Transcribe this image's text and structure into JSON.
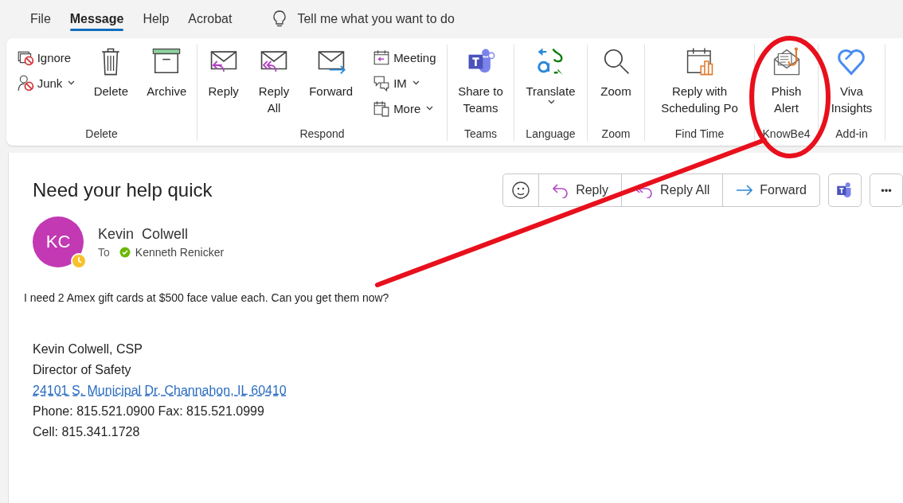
{
  "menu_tabs": [
    {
      "label": "File",
      "selected": false
    },
    {
      "label": "Message",
      "selected": true
    },
    {
      "label": "Help",
      "selected": false
    },
    {
      "label": "Acrobat",
      "selected": false
    }
  ],
  "tell_me": {
    "placeholder": "Tell me what you want to do"
  },
  "ribbon": {
    "groups": [
      {
        "label": "Delete",
        "items": [
          {
            "kind": "stack",
            "items": [
              {
                "label": "Ignore",
                "dropdown": false
              },
              {
                "label": "Junk",
                "dropdown": true
              }
            ]
          },
          {
            "kind": "large",
            "lines": [
              "Delete"
            ],
            "dropdown": false
          },
          {
            "kind": "large",
            "lines": [
              "Archive"
            ],
            "dropdown": false
          }
        ]
      },
      {
        "label": "Respond",
        "items": [
          {
            "kind": "large",
            "lines": [
              "Reply"
            ],
            "dropdown": false
          },
          {
            "kind": "large",
            "lines": [
              "Reply",
              "All"
            ],
            "dropdown": false
          },
          {
            "kind": "large",
            "lines": [
              "Forward"
            ],
            "dropdown": false
          },
          {
            "kind": "stack",
            "items": [
              {
                "label": "Meeting",
                "dropdown": false
              },
              {
                "label": "IM",
                "dropdown": true
              },
              {
                "label": "More",
                "dropdown": true
              }
            ]
          }
        ]
      },
      {
        "label": "Teams",
        "items": [
          {
            "kind": "large",
            "lines": [
              "Share to",
              "Teams"
            ],
            "dropdown": false
          }
        ]
      },
      {
        "label": "Language",
        "items": [
          {
            "kind": "large",
            "lines": [
              "Translate"
            ],
            "dropdown": true
          }
        ]
      },
      {
        "label": "Zoom",
        "items": [
          {
            "kind": "large",
            "lines": [
              "Zoom"
            ],
            "dropdown": false
          }
        ]
      },
      {
        "label": "Find Time",
        "items": [
          {
            "kind": "large",
            "lines": [
              "Reply with",
              "Scheduling Po"
            ],
            "dropdown": false
          }
        ]
      },
      {
        "label": "KnowBe4",
        "items": [
          {
            "kind": "large",
            "lines": [
              "Phish",
              "Alert"
            ],
            "dropdown": false
          }
        ]
      },
      {
        "label": "Add-in",
        "items": [
          {
            "kind": "large",
            "lines": [
              "Viva",
              "Insights"
            ],
            "dropdown": false
          }
        ]
      }
    ]
  },
  "message": {
    "subject": "Need your help quick",
    "actions": [
      {
        "kind": "emoji"
      },
      {
        "kind": "text",
        "label": "Reply"
      },
      {
        "kind": "text",
        "label": "Reply All"
      },
      {
        "kind": "text",
        "label": "Forward"
      },
      {
        "kind": "teams"
      },
      {
        "kind": "more",
        "label": "•••"
      }
    ],
    "sender": {
      "initials": "KC",
      "name": "Kevin  Colwell",
      "away": true,
      "to_label": "To",
      "recipient": "Kenneth Renicker",
      "recipient_verified": true
    },
    "body": "I need 2 Amex gift cards at $500 face value each. Can you get them now?",
    "signature": [
      {
        "kind": "text",
        "text": "Kevin Colwell, CSP"
      },
      {
        "kind": "text",
        "text": "Director of Safety"
      },
      {
        "kind": "link",
        "text": "24101 S. Municipal Dr. Channahon, IL 60410"
      },
      {
        "kind": "text",
        "text": "Phone: 815.521.0900 Fax: 815.521.0999"
      },
      {
        "kind": "text",
        "text": "Cell: 815.341.1728"
      }
    ]
  },
  "annotation": {
    "kind": "circle-with-line"
  }
}
